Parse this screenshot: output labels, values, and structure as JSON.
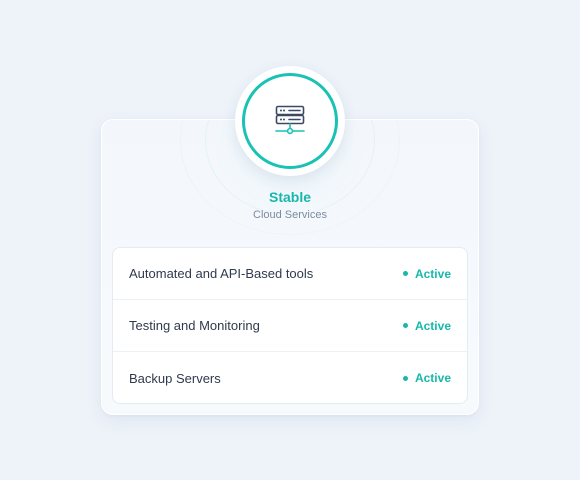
{
  "service": {
    "title": "Stable",
    "subtitle": "Cloud Services",
    "icon": "server-network-icon",
    "accent_color": "#19c2b4"
  },
  "items": [
    {
      "label": "Automated and API-Based tools",
      "status": "Active"
    },
    {
      "label": "Testing and Monitoring",
      "status": "Active"
    },
    {
      "label": "Backup Servers",
      "status": "Active"
    }
  ]
}
